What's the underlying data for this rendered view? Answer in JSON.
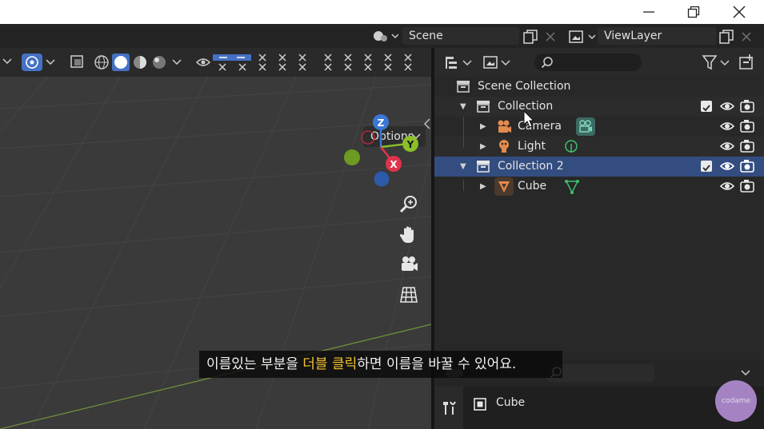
{
  "window_controls": {
    "minimize": "minimize-icon",
    "restore": "restore-icon",
    "close": "close-icon"
  },
  "topbar": {
    "scene_name": "Scene",
    "view_layer_name": "ViewLayer"
  },
  "viewport": {
    "options_label": "Options",
    "gizmo": {
      "z_label": "Z",
      "y_label": "Y",
      "x_label": "X"
    },
    "nav_tools": [
      "zoom-icon",
      "pan-hand-icon",
      "camera-view-icon",
      "ortho-grid-icon"
    ]
  },
  "outliner": {
    "root_label": "Scene Collection",
    "rows": [
      {
        "label": "Collection",
        "kind": "collection",
        "selected": false,
        "checked": true
      },
      {
        "label": "Camera",
        "kind": "object-camera",
        "selected": false
      },
      {
        "label": "Light",
        "kind": "object-light",
        "selected": false
      },
      {
        "label": "Collection 2",
        "kind": "collection",
        "selected": true,
        "checked": true
      },
      {
        "label": "Cube",
        "kind": "object-mesh",
        "selected": false
      }
    ]
  },
  "properties": {
    "object_name": "Cube"
  },
  "subtitle": {
    "before": "이름있는 부분을 ",
    "highlight": "더블 클릭",
    "after": "하면 이름을 바꿀 수 있어요."
  },
  "watermark": {
    "text": "codame"
  },
  "colors": {
    "selection": "#334d80",
    "subtitle_highlight": "#f4c431",
    "axis_x": "#e0344c",
    "axis_y": "#8bbf2b",
    "axis_z": "#3b78d6",
    "header_active": "#4571c4"
  }
}
